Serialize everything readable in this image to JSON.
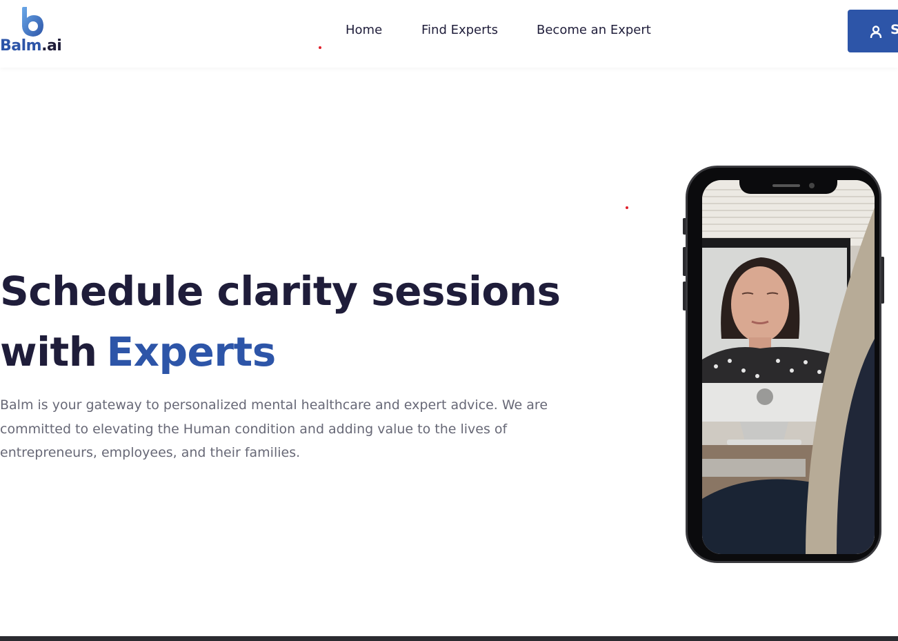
{
  "header": {
    "logo": {
      "brand": "Balm",
      "tld": ".ai"
    },
    "nav": [
      {
        "label": "Home"
      },
      {
        "label": "Find Experts"
      },
      {
        "label": "Become an Expert"
      }
    ],
    "cta": {
      "label": "S",
      "icon": "user-icon"
    }
  },
  "hero": {
    "title_line1": "Schedule clarity sessions",
    "title_line2_prefix": "with",
    "title_line2_accent": "Experts",
    "description": "Balm is your gateway to personalized mental healthcare and expert advice. We are committed to elevating the Human condition and adding value to the lives of entrepreneurs, employees, and their families."
  },
  "phone": {
    "screen_icon": "video-call-image"
  },
  "colors": {
    "primary": "#2d55a8",
    "heading": "#1f1d3a",
    "body_text": "#676876",
    "dot_red": "#e0202b",
    "footer_bar": "#2b2b30"
  }
}
